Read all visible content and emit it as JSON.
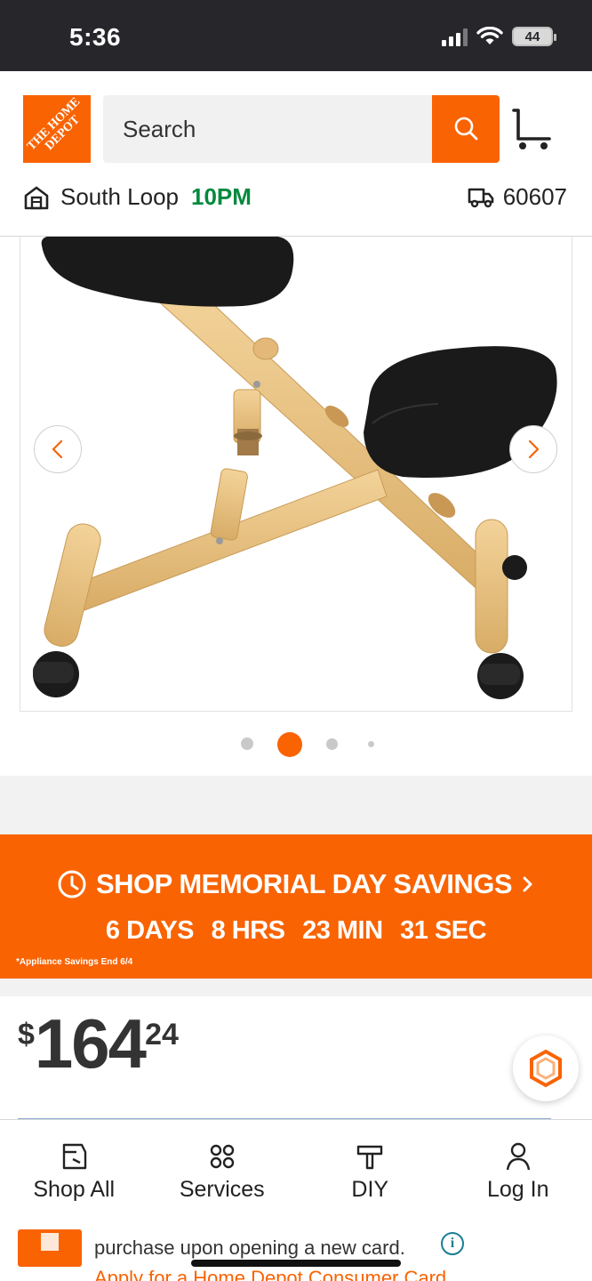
{
  "status_bar": {
    "time": "5:36",
    "battery": "44"
  },
  "header": {
    "logo_text": "THE HOME DEPOT",
    "search_placeholder": "Search",
    "store_name": "South Loop",
    "store_hours": "10PM",
    "zip": "60607"
  },
  "gallery": {
    "active_slide": 2,
    "total_dots": 4
  },
  "promo": {
    "title": "SHOP MEMORIAL DAY SAVINGS",
    "countdown": {
      "days": "6 DAYS",
      "hours": "8 HRS",
      "minutes": "23 MIN",
      "seconds": "31 SEC"
    },
    "note": "*Appliance Savings End 6/4"
  },
  "price": {
    "dollar_sign": "$",
    "whole": "164",
    "cents": "24"
  },
  "bottom_nav": {
    "items": [
      {
        "label": "Shop All",
        "icon": "shop-all-icon"
      },
      {
        "label": "Services",
        "icon": "services-icon"
      },
      {
        "label": "DIY",
        "icon": "diy-icon"
      },
      {
        "label": "Log In",
        "icon": "user-icon"
      }
    ]
  },
  "card_offer": {
    "text": "purchase upon opening a new card.",
    "link": "Apply for a Home Depot Consumer Card"
  },
  "colors": {
    "brand_orange": "#f96302",
    "store_green": "#00893d",
    "status_bar": "#26262b"
  }
}
